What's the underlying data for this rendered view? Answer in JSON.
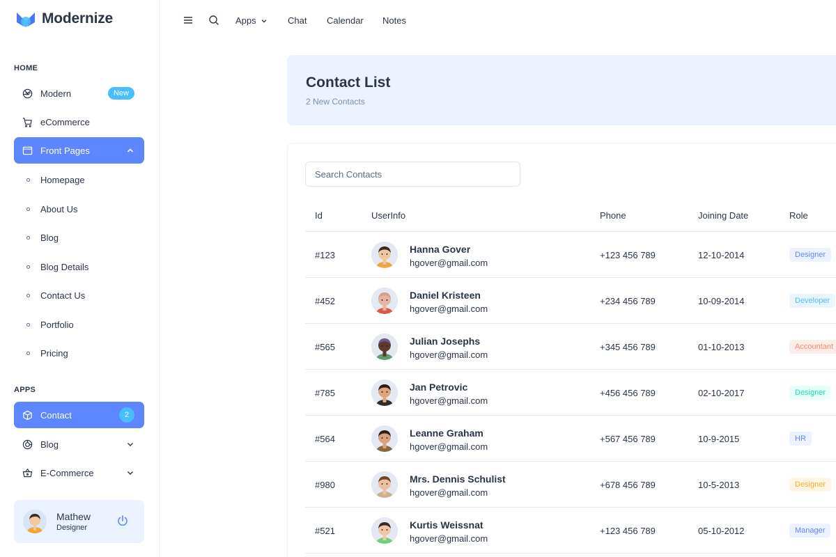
{
  "app": {
    "name": "Modernize"
  },
  "sidebar": {
    "home_label": "HOME",
    "apps_label": "APPS",
    "items": [
      {
        "label": "Modern",
        "icon": "aperture-icon",
        "badge": "New"
      },
      {
        "label": "eCommerce",
        "icon": "shopping-cart-icon"
      },
      {
        "label": "Front Pages",
        "icon": "app-window-icon"
      }
    ],
    "front_pages_sub": [
      "Homepage",
      "About Us",
      "Blog",
      "Blog Details",
      "Contact Us",
      "Portfolio",
      "Pricing"
    ],
    "apps_items": [
      {
        "label": "Contact",
        "icon": "package-icon",
        "badge": "2"
      },
      {
        "label": "Blog",
        "icon": "chart-donut-icon"
      },
      {
        "label": "E-Commerce",
        "icon": "basket-icon"
      }
    ],
    "profile": {
      "name": "Mathew",
      "role": "Designer"
    }
  },
  "topbar": {
    "links": [
      "Apps",
      "Chat",
      "Calendar",
      "Notes"
    ]
  },
  "header": {
    "title": "Contact List",
    "subtitle": "2 New Contacts"
  },
  "search": {
    "placeholder": "Search Contacts"
  },
  "table": {
    "columns": [
      "Id",
      "UserInfo",
      "Phone",
      "Joining Date",
      "Role"
    ],
    "rows": [
      {
        "id": "#123",
        "name": "Hanna Gover",
        "email": "hgover@gmail.com",
        "phone": "+123 456 789",
        "date": "12-10-2014",
        "role": "Designer",
        "role_bg": "#ecf2ff",
        "role_fg": "#5d87ff",
        "avatar_bg": "#e3e8f1",
        "skin": "#f1c7a1",
        "hair": "#3a2a1f",
        "shirt": "#f0a63b"
      },
      {
        "id": "#452",
        "name": "Daniel Kristeen",
        "email": "hgover@gmail.com",
        "phone": "+234 456 789",
        "date": "10-09-2014",
        "role": "Developer",
        "role_bg": "#e8f7ff",
        "role_fg": "#49beff",
        "avatar_bg": "#e3e8f1",
        "skin": "#e9b3a2",
        "hair": "#c9a58c",
        "shirt": "#d85a4a"
      },
      {
        "id": "#565",
        "name": "Julian Josephs",
        "email": "hgover@gmail.com",
        "phone": "+345 456 789",
        "date": "01-10-2013",
        "role": "Accountant",
        "role_bg": "#fdede8",
        "role_fg": "#fa896b",
        "avatar_bg": "#e3e8f1",
        "skin": "#5b3a2a",
        "hair": "#6b5b8a",
        "shirt": "#5c9b6a"
      },
      {
        "id": "#785",
        "name": "Jan Petrovic",
        "email": "hgover@gmail.com",
        "phone": "+456 456 789",
        "date": "02-10-2017",
        "role": "Designer",
        "role_bg": "#e6fffa",
        "role_fg": "#13deb9",
        "avatar_bg": "#e3e8f1",
        "skin": "#e0a57e",
        "hair": "#2b1d17",
        "shirt": "#2b2b2b"
      },
      {
        "id": "#564",
        "name": "Leanne Graham",
        "email": "hgover@gmail.com",
        "phone": "+567 456 789",
        "date": "10-9-2015",
        "role": "HR",
        "role_bg": "#ecf2ff",
        "role_fg": "#5d87ff",
        "avatar_bg": "#e3e8f1",
        "skin": "#d9a27f",
        "hair": "#2b1d17",
        "shirt": "#8a6a3a"
      },
      {
        "id": "#980",
        "name": "Mrs. Dennis Schulist",
        "email": "hgover@gmail.com",
        "phone": "+678 456 789",
        "date": "10-5-2013",
        "role": "Designer",
        "role_bg": "#fef5e5",
        "role_fg": "#ffae1f",
        "avatar_bg": "#e3e8f1",
        "skin": "#eec0a0",
        "hair": "#6a4a2a",
        "shirt": "#c9b28c"
      },
      {
        "id": "#521",
        "name": "Kurtis Weissnat",
        "email": "hgover@gmail.com",
        "phone": "+123 456 789",
        "date": "05-10-2012",
        "role": "Manager",
        "role_bg": "#ecf2ff",
        "role_fg": "#5d87ff",
        "avatar_bg": "#e3e8f1",
        "skin": "#f1c7a1",
        "hair": "#3a2a1f",
        "shirt": "#6fcf7a"
      }
    ]
  },
  "colors": {
    "primary": "#5d87ff",
    "secondary": "#49beff",
    "light_primary": "#ecf2ff",
    "text": "#2a3547"
  }
}
